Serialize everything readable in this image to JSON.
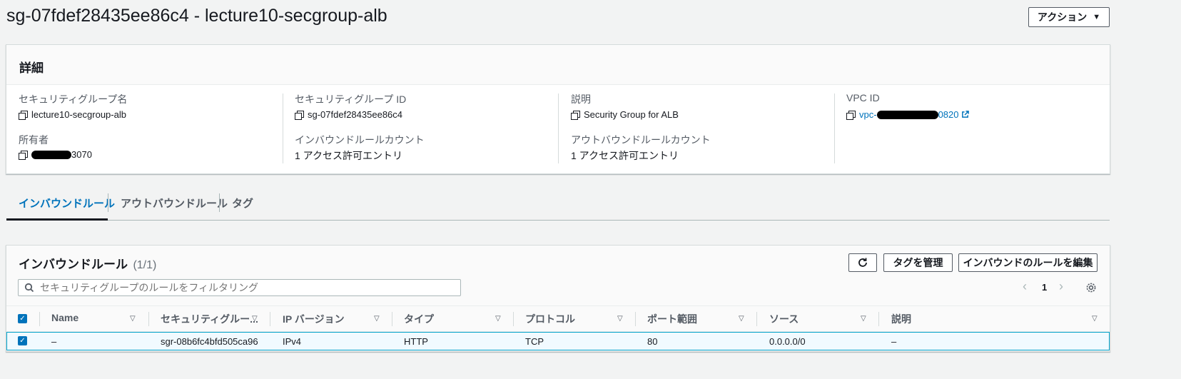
{
  "header": {
    "title": "sg-07fdef28435ee86c4 - lecture10-secgroup-alb",
    "actions_label": "アクション"
  },
  "details": {
    "heading": "詳細",
    "fields": {
      "sg_name": {
        "label": "セキュリティグループ名",
        "value": "lecture10-secgroup-alb"
      },
      "sg_id": {
        "label": "セキュリティグループ ID",
        "value": "sg-07fdef28435ee86c4"
      },
      "description": {
        "label": "説明",
        "value": "Security Group for ALB"
      },
      "vpc_id": {
        "label": "VPC ID",
        "value_prefix": "vpc-",
        "value_suffix": "0820"
      },
      "owner": {
        "label": "所有者",
        "value_suffix": "3070"
      },
      "inbound_count": {
        "label": "インバウンドルールカウント",
        "value": "1 アクセス許可エントリ"
      },
      "outbound_count": {
        "label": "アウトバウンドルールカウント",
        "value": "1 アクセス許可エントリ"
      }
    }
  },
  "tabs": [
    {
      "label": "インバウンドルール",
      "active": true
    },
    {
      "label": "アウトバウンドルール",
      "active": false
    },
    {
      "label": "タグ",
      "active": false
    }
  ],
  "rules_panel": {
    "title": "インバウンドルール",
    "count": "(1/1)",
    "manage_tags_label": "タグを管理",
    "edit_rules_label": "インバウンドのルールを編集",
    "filter_placeholder": "セキュリティグループのルールをフィルタリング",
    "page_number": "1",
    "columns": [
      "Name",
      "セキュリティグルー...",
      "IP バージョン",
      "タイプ",
      "プロトコル",
      "ポート範囲",
      "ソース",
      "説明"
    ],
    "rows": [
      {
        "name": "–",
        "rule_id": "sgr-08b6fc4bfd505ca96",
        "ip_version": "IPv4",
        "type": "HTTP",
        "protocol": "TCP",
        "port_range": "80",
        "source": "0.0.0.0/0",
        "description": "–"
      }
    ]
  },
  "colors": {
    "accent": "#0073bb",
    "background": "#f2f3f3"
  }
}
